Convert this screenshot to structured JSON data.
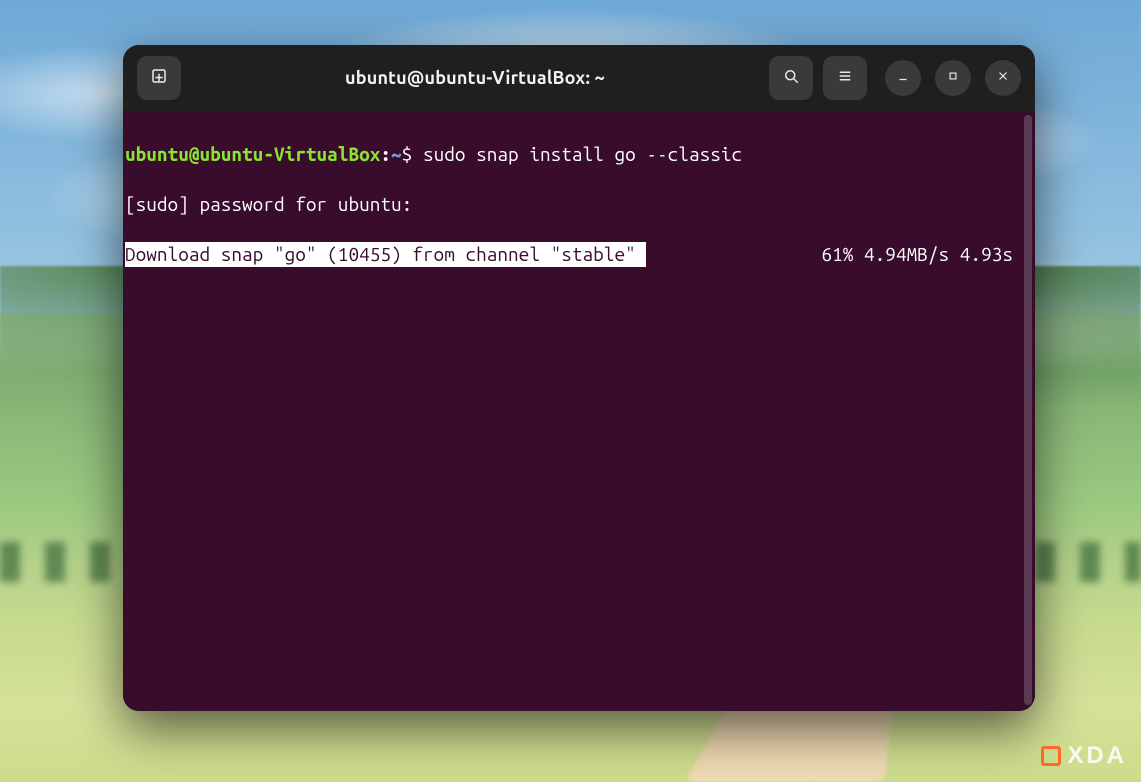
{
  "titlebar": {
    "title": "ubuntu@ubuntu-VirtualBox: ~",
    "new_tab_icon": "new-tab-icon",
    "search_icon": "search-icon",
    "menu_icon": "hamburger-icon",
    "minimize_icon": "minimize-icon",
    "maximize_icon": "maximize-icon",
    "close_icon": "close-icon"
  },
  "terminal": {
    "prompt": {
      "user_host": "ubuntu@ubuntu-VirtualBox",
      "separator": ":",
      "cwd": "~",
      "symbol": "$"
    },
    "command": "sudo snap install go --classic",
    "sudo_line": "[sudo] password for ubuntu:",
    "download": {
      "text": "Download snap \"go\" (10455) from channel \"stable\" ",
      "percent": "61%",
      "speed": "4.94MB/s",
      "eta": "4.93s"
    }
  },
  "watermark": {
    "text": "XDA"
  },
  "colors": {
    "term_bg": "#380c2a",
    "prompt_green": "#8ae234",
    "prompt_blue": "#729fcf",
    "highlight_bg": "#ffffff",
    "highlight_fg": "#380c2a"
  }
}
